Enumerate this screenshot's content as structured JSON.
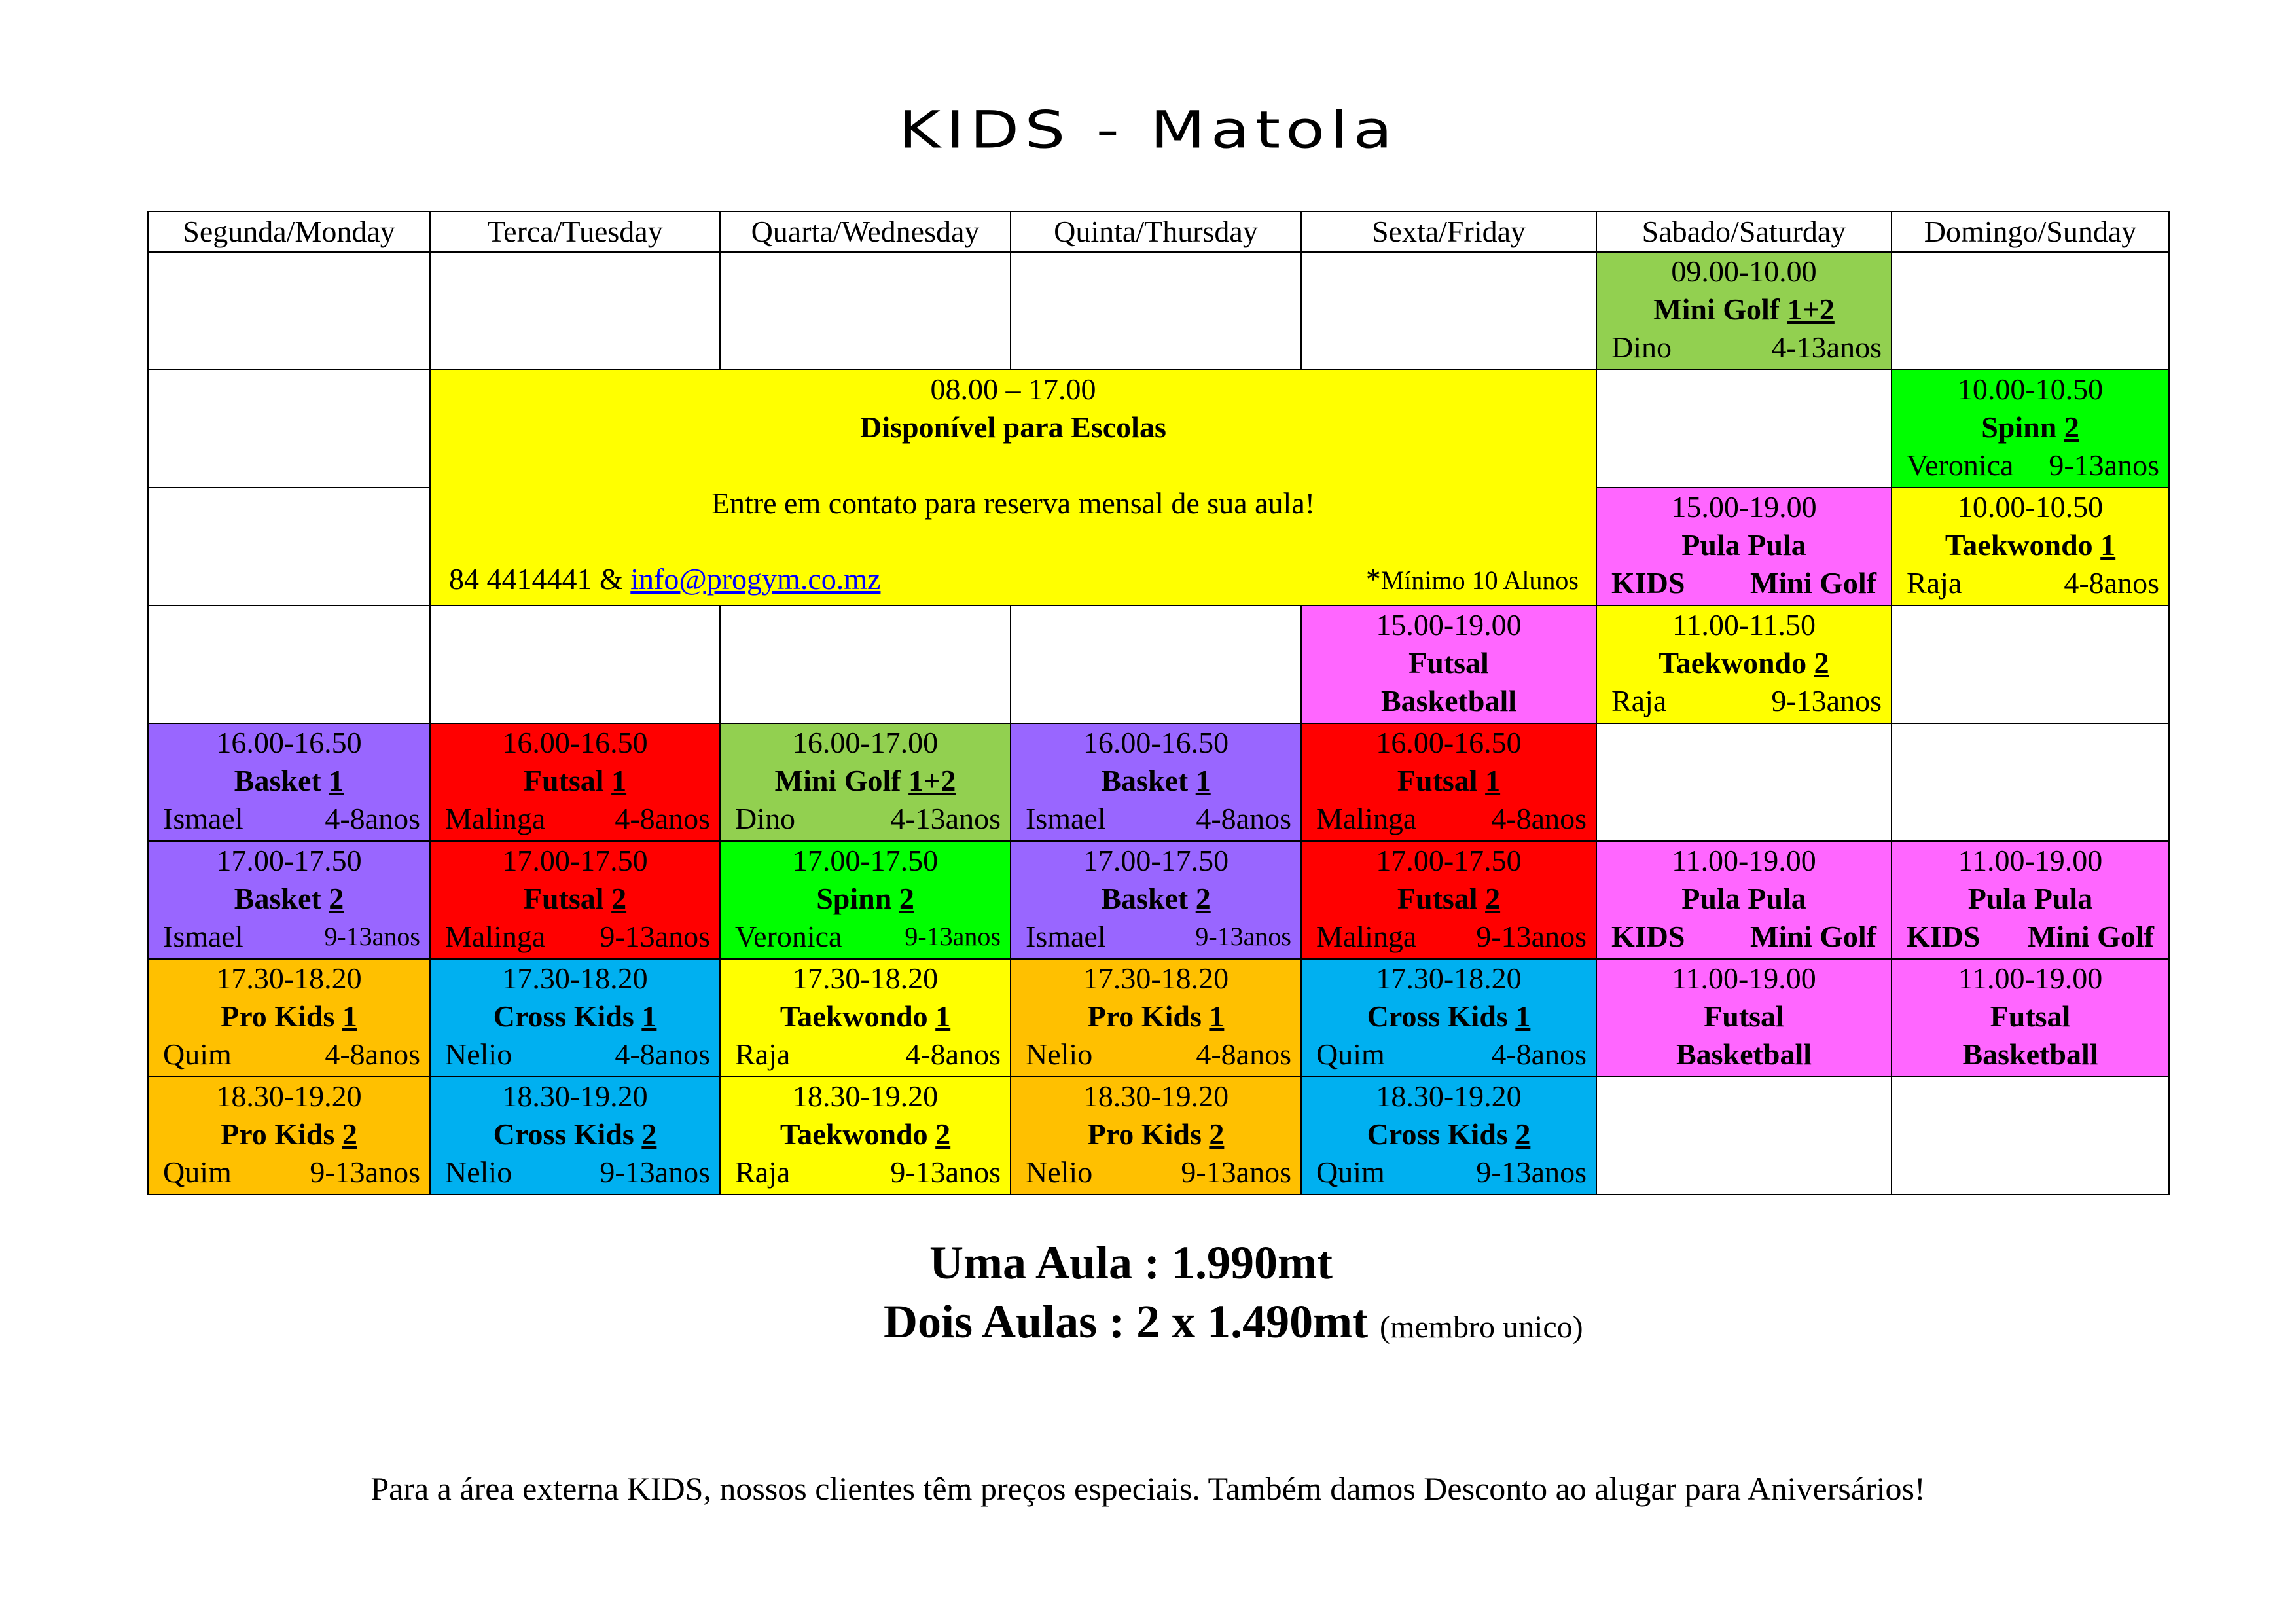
{
  "title": "KIDS - Matola",
  "days": [
    "Segunda/Monday",
    "Terca/Tuesday",
    "Quarta/Wednesday",
    "Quinta/Thursday",
    "Sexta/Friday",
    "Sabado/Saturday",
    "Domingo/Sunday"
  ],
  "colors": {
    "purple": "#9966ff",
    "red": "#ff0000",
    "light_green": "#92d050",
    "green": "#00ff00",
    "magenta": "#ff66ff",
    "yellow": "#ffff00",
    "orange": "#ffc000",
    "cyan": "#00b0f0"
  },
  "promo": {
    "time": "08.00 – 17.00",
    "title": "Disponível para Escolas",
    "text": "Entre em contato para reserva mensal de sua aula!",
    "phone": "84 4414441 & ",
    "email": "info@progym.co.mz",
    "min_star": "*",
    "min": "Mínimo 10 Alunos"
  },
  "sat": {
    "r1": {
      "time": "09.00-10.00",
      "name": "Mini Golf ",
      "num": "1+2",
      "trainer": "Dino",
      "age": "4-13anos"
    },
    "r2": {
      "time": "10.00-10.50",
      "name": "Spinn ",
      "num": "2",
      "trainer": "Veronica",
      "age": "9-13anos"
    },
    "r3": {
      "time": "10.00-10.50",
      "name": "Taekwondo ",
      "num": "1",
      "trainer": "Raja",
      "age": "4-8anos"
    },
    "r4": {
      "time": "11.00-11.50",
      "name": "Taekwondo ",
      "num": "2",
      "trainer": "Raja",
      "age": "9-13anos"
    },
    "r6": {
      "time": "11.00-19.00",
      "name": "Pula Pula",
      "left": "KIDS",
      "right": "Mini Golf"
    },
    "r7": {
      "time": "11.00-19.00",
      "line1": "Futsal",
      "line2": "Basketball"
    }
  },
  "sun": {
    "r6": {
      "time": "11.00-19.00",
      "name": "Pula Pula",
      "left": "KIDS",
      "right": "Mini Golf"
    },
    "r7": {
      "time": "11.00-19.00",
      "line1": "Futsal",
      "line2": "Basketball"
    }
  },
  "fri": {
    "r3": {
      "time": "15.00-19.00",
      "name": "Pula Pula",
      "left": "KIDS",
      "right": "Mini Golf"
    },
    "r4": {
      "time": "15.00-19.00",
      "line1": "Futsal",
      "line2": "Basketball"
    }
  },
  "row5": [
    {
      "time": "16.00-16.50",
      "name": "Basket ",
      "num": "1",
      "trainer": "Ismael",
      "age": "4-8anos"
    },
    {
      "time": "16.00-16.50",
      "name": "Futsal ",
      "num": "1",
      "trainer": "Malinga",
      "age": "4-8anos"
    },
    {
      "time": "16.00-17.00",
      "name": "Mini Golf ",
      "num": "1+2",
      "trainer": "Dino",
      "age": "4-13anos"
    },
    {
      "time": "16.00-16.50",
      "name": "Basket ",
      "num": "1",
      "trainer": "Ismael",
      "age": "4-8anos"
    },
    {
      "time": "16.00-16.50",
      "name": "Futsal ",
      "num": "1",
      "trainer": "Malinga",
      "age": "4-8anos"
    }
  ],
  "row6": [
    {
      "time": "17.00-17.50",
      "name": "Basket ",
      "num": "2",
      "trainer": "Ismael",
      "age": "9-13anos"
    },
    {
      "time": "17.00-17.50",
      "name": "Futsal ",
      "num": "2",
      "trainer": "Malinga",
      "age": "9-13anos"
    },
    {
      "time": "17.00-17.50",
      "name": "Spinn ",
      "num": "2",
      "trainer": "Veronica",
      "age": "9-13anos"
    },
    {
      "time": "17.00-17.50",
      "name": "Basket ",
      "num": "2",
      "trainer": "Ismael",
      "age": "9-13anos"
    },
    {
      "time": "17.00-17.50",
      "name": "Futsal ",
      "num": "2",
      "trainer": "Malinga",
      "age": "9-13anos"
    }
  ],
  "row7": [
    {
      "time": "17.30-18.20",
      "name": "Pro Kids ",
      "num": "1",
      "trainer": "Quim",
      "age": "4-8anos"
    },
    {
      "time": "17.30-18.20",
      "name": "Cross Kids ",
      "num": "1",
      "trainer": "Nelio",
      "age": "4-8anos"
    },
    {
      "time": "17.30-18.20",
      "name": "Taekwondo ",
      "num": "1",
      "trainer": "Raja",
      "age": "4-8anos"
    },
    {
      "time": "17.30-18.20",
      "name": "Pro Kids ",
      "num": "1",
      "trainer": "Nelio",
      "age": "4-8anos"
    },
    {
      "time": "17.30-18.20",
      "name": "Cross Kids ",
      "num": "1",
      "trainer": "Quim",
      "age": "4-8anos"
    }
  ],
  "row8": [
    {
      "time": "18.30-19.20",
      "name": "Pro Kids ",
      "num": "2",
      "trainer": "Quim",
      "age": "9-13anos"
    },
    {
      "time": "18.30-19.20",
      "name": "Cross Kids ",
      "num": "2",
      "trainer": "Nelio",
      "age": "9-13anos"
    },
    {
      "time": "18.30-19.20",
      "name": "Taekwondo ",
      "num": "2",
      "trainer": "Raja",
      "age": "9-13anos"
    },
    {
      "time": "18.30-19.20",
      "name": "Pro Kids ",
      "num": "2",
      "trainer": "Nelio",
      "age": "9-13anos"
    },
    {
      "time": "18.30-19.20",
      "name": "Cross Kids ",
      "num": "2",
      "trainer": "Quim",
      "age": "9-13anos"
    }
  ],
  "pricing": {
    "one": "Uma Aula : 1.990mt",
    "two": "Dois Aulas : 2 x 1.490mt",
    "two_note": "(membro unico)"
  },
  "footer": "Para a área externa KIDS, nossos clientes têm preços especiais. Também damos Desconto ao alugar para Aniversários!"
}
